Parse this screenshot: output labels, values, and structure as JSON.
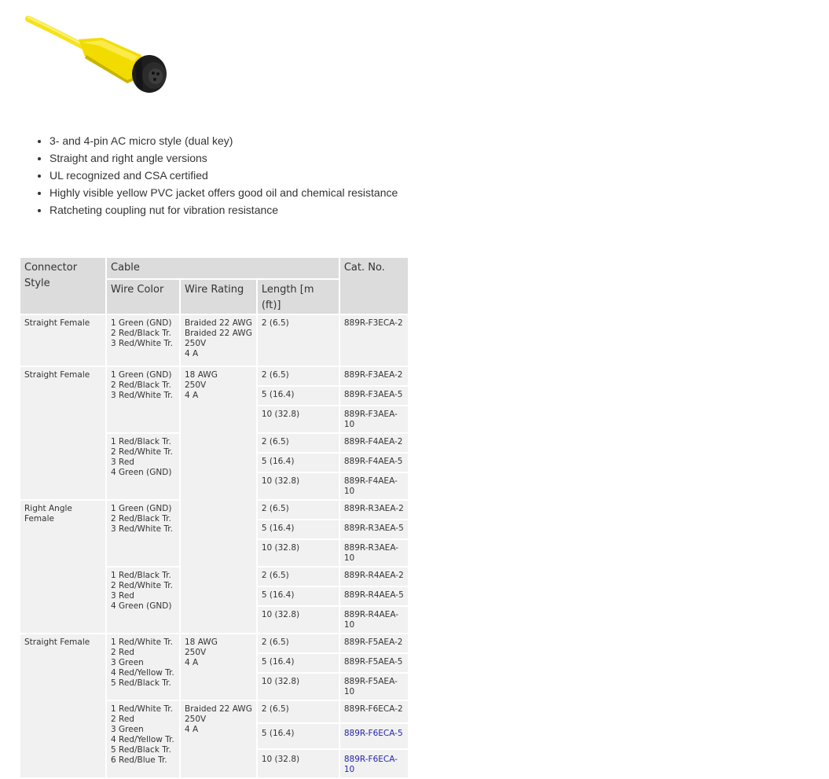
{
  "product_image": {
    "description_icon": "yellow-cable-connector"
  },
  "features": [
    "3- and 4-pin AC micro style (dual key)",
    "Straight and right angle versions",
    "UL recognized and CSA certified",
    "Highly visible yellow PVC jacket offers good oil and chemical resistance",
    "Ratcheting coupling nut for vibration resistance"
  ],
  "table": {
    "headers": {
      "connector_style": "Connector Style",
      "cable": "Cable",
      "cat_no": "Cat. No.",
      "wire_color": "Wire Color",
      "wire_rating": "Wire Rating",
      "length": "Length [m (ft)]"
    },
    "groups": {
      "g1": {
        "style": "Straight Female",
        "color": "1 Green (GND)\n2 Red/Black Tr.\n3 Red/White Tr.",
        "rating": "Braided 22 AWG\nBraided 22 AWG\n250V\n4 A",
        "rows": [
          {
            "length": "2 (6.5)",
            "cat": "889R-F3ECA-2"
          }
        ]
      },
      "g2": {
        "style": "Straight Female",
        "color_a": "1 Green (GND)\n2 Red/Black Tr.\n3 Red/White Tr.",
        "color_b": "1 Red/Black Tr.\n2 Red/White Tr.\n3 Red\n4 Green (GND)",
        "rating": "18 AWG\n250V\n4 A",
        "rows": [
          {
            "length": "2 (6.5)",
            "cat": "889R-F3AEA-2"
          },
          {
            "length": "5 (16.4)",
            "cat": "889R-F3AEA-5"
          },
          {
            "length": "10 (32.8)",
            "cat": "889R-F3AEA-10"
          },
          {
            "length": "2 (6.5)",
            "cat": "889R-F4AEA-2"
          },
          {
            "length": "5 (16.4)",
            "cat": "889R-F4AEA-5"
          },
          {
            "length": "10 (32.8)",
            "cat": "889R-F4AEA-10"
          }
        ]
      },
      "g3": {
        "style": "Right Angle Female",
        "color_a": "1 Green (GND)\n2 Red/Black Tr.\n3 Red/White Tr.",
        "color_b": "1 Red/Black Tr.\n2 Red/White Tr.\n3 Red\n4 Green (GND)",
        "rows": [
          {
            "length": "2 (6.5)",
            "cat": "889R-R3AEA-2"
          },
          {
            "length": "5 (16.4)",
            "cat": "889R-R3AEA-5"
          },
          {
            "length": "10 (32.8)",
            "cat": "889R-R3AEA-10"
          },
          {
            "length": "2 (6.5)",
            "cat": "889R-R4AEA-2"
          },
          {
            "length": "5 (16.4)",
            "cat": "889R-R4AEA-5"
          },
          {
            "length": "10 (32.8)",
            "cat": "889R-R4AEA-10"
          }
        ]
      },
      "g4": {
        "style": "Straight Female",
        "color_a": "1 Red/White Tr.\n2 Red\n3 Green\n4 Red/Yellow Tr.\n5 Red/Black Tr.",
        "color_b": "1 Red/White Tr.\n2 Red\n3 Green\n4 Red/Yellow Tr.\n5 Red/Black Tr.\n6 Red/Blue Tr.",
        "rating_a": "18 AWG\n250V\n4 A",
        "rating_b": "Braided 22 AWG\n250V\n4 A",
        "rows": [
          {
            "length": "2 (6.5)",
            "cat": "889R-F5AEA-2"
          },
          {
            "length": "5 (16.4)",
            "cat": "889R-F5AEA-5"
          },
          {
            "length": "10 (32.8)",
            "cat": "889R-F5AEA-10"
          },
          {
            "length": "2 (6.5)",
            "cat": "889R-F6ECA-2"
          },
          {
            "length": "5 (16.4)",
            "cat": "889R-F6ECA-5"
          },
          {
            "length": "10 (32.8)",
            "cat": "889R-F6ECA-10"
          }
        ]
      }
    }
  },
  "colors": {
    "header_bg": "#dcdcdc",
    "cell_bg": "#f1f1f1",
    "link": "#2525a8",
    "cable_yellow": "#f2dd00"
  }
}
